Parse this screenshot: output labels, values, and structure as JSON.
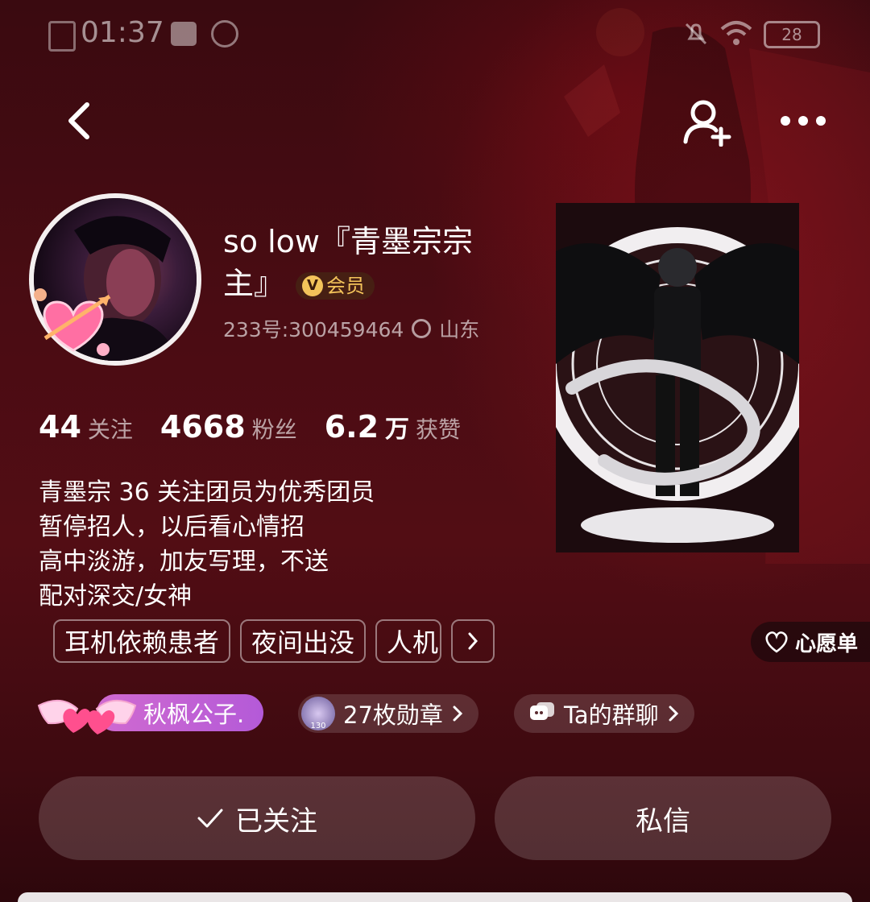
{
  "status_bar": {
    "time": "01:37",
    "battery": "28"
  },
  "profile": {
    "name": "so low『青墨宗宗主』",
    "vip_label": "会员",
    "id_text": "233号:300459464",
    "location": "山东"
  },
  "stats": [
    {
      "value": "44",
      "unit": "",
      "label": "关注"
    },
    {
      "value": "4668",
      "unit": "",
      "label": "粉丝"
    },
    {
      "value": "6.2",
      "unit": "万",
      "label": "获赞"
    }
  ],
  "bio": [
    "青墨宗 36  关注团员为优秀团员",
    "暂停招人，以后看心情招",
    "高中淡游，加友写理，不送",
    "配对深交/女神"
  ],
  "tags": [
    "耳机依赖患者",
    "夜间出没",
    "人机"
  ],
  "wishlist_label": "心愿单",
  "cp": {
    "name": "秋枫公子."
  },
  "medals": {
    "label": "27枚勋章",
    "badge_number": "130"
  },
  "group_chat": {
    "label": "Ta的群聊"
  },
  "actions": {
    "follow_label": "已关注",
    "message_label": "私信"
  },
  "colors": {
    "accent_gold": "#f3c35a",
    "cp_purple": "#b45ad8",
    "cp_pink": "#ff4f8e"
  }
}
